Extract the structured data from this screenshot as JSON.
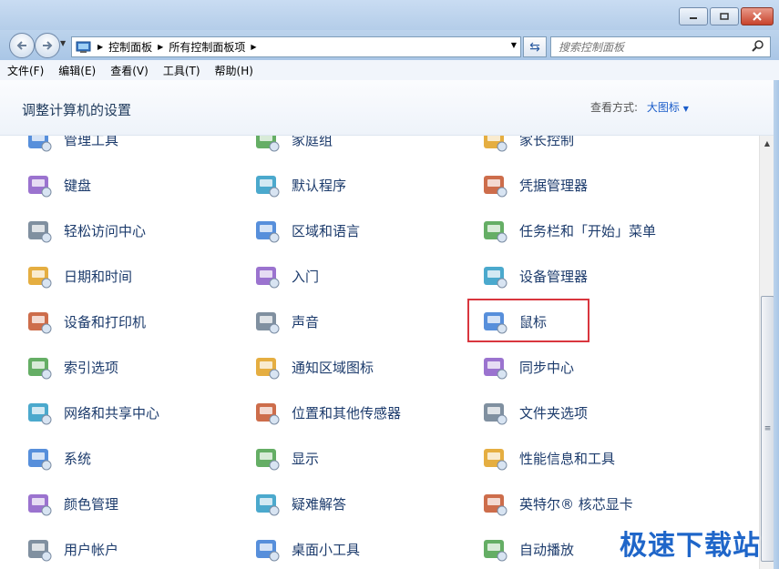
{
  "addressbar": {
    "crumbs": [
      "控制面板",
      "所有控制面板项"
    ],
    "search_placeholder": "搜索控制面板"
  },
  "menubar": [
    "文件(F)",
    "编辑(E)",
    "查看(V)",
    "工具(T)",
    "帮助(H)"
  ],
  "header": {
    "title": "调整计算机的设置",
    "view_by_label": "查看方式:",
    "view_by_value": "大图标"
  },
  "items": [
    [
      "管理工具",
      "家庭组",
      "家长控制"
    ],
    [
      "键盘",
      "默认程序",
      "凭据管理器"
    ],
    [
      "轻松访问中心",
      "区域和语言",
      "任务栏和「开始」菜单"
    ],
    [
      "日期和时间",
      "入门",
      "设备管理器"
    ],
    [
      "设备和打印机",
      "声音",
      "鼠标"
    ],
    [
      "索引选项",
      "通知区域图标",
      "同步中心"
    ],
    [
      "网络和共享中心",
      "位置和其他传感器",
      "文件夹选项"
    ],
    [
      "系统",
      "显示",
      "性能信息和工具"
    ],
    [
      "颜色管理",
      "疑难解答",
      "英特尔® 核芯显卡"
    ],
    [
      "用户帐户",
      "桌面小工具",
      "自动播放"
    ]
  ],
  "icons": [
    [
      "admin-tools-icon",
      "homegroup-icon",
      "parental-controls-icon"
    ],
    [
      "keyboard-icon",
      "default-programs-icon",
      "credential-manager-icon"
    ],
    [
      "ease-of-access-icon",
      "region-language-icon",
      "taskbar-start-menu-icon"
    ],
    [
      "date-time-icon",
      "getting-started-icon",
      "device-manager-icon"
    ],
    [
      "devices-printers-icon",
      "sound-icon",
      "mouse-icon"
    ],
    [
      "indexing-options-icon",
      "notification-area-icon",
      "sync-center-icon"
    ],
    [
      "network-sharing-icon",
      "location-sensors-icon",
      "folder-options-icon"
    ],
    [
      "system-icon",
      "display-icon",
      "performance-icon"
    ],
    [
      "color-management-icon",
      "troubleshooting-icon",
      "intel-graphics-icon"
    ],
    [
      "user-accounts-icon",
      "desktop-gadgets-icon",
      "autoplay-icon"
    ]
  ],
  "highlighted_item": "鼠标",
  "watermark": "极速下载站"
}
